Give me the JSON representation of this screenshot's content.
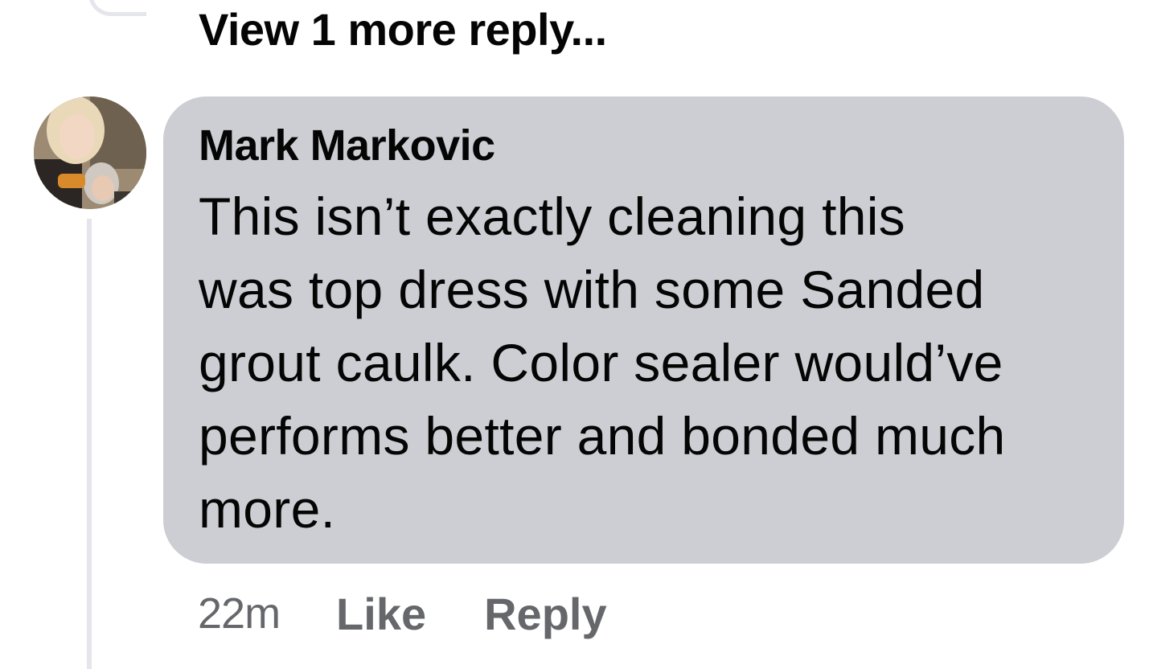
{
  "thread": {
    "view_more_label": "View 1 more reply..."
  },
  "comment": {
    "author": "Mark Markovic",
    "avatar": "profile-photo",
    "text": "This isn’t exactly cleaning this\nwas top dress with some  Sanded\ngrout caulk. Color sealer would’ve\nperforms better and bonded much\nmore.",
    "timestamp": "22m",
    "like_label": "Like",
    "reply_label": "Reply"
  },
  "colors": {
    "bubble_background": "#cdced3",
    "secondary_text": "#65676b",
    "thread_line": "#e4e6eb",
    "primary_text": "#050505"
  }
}
